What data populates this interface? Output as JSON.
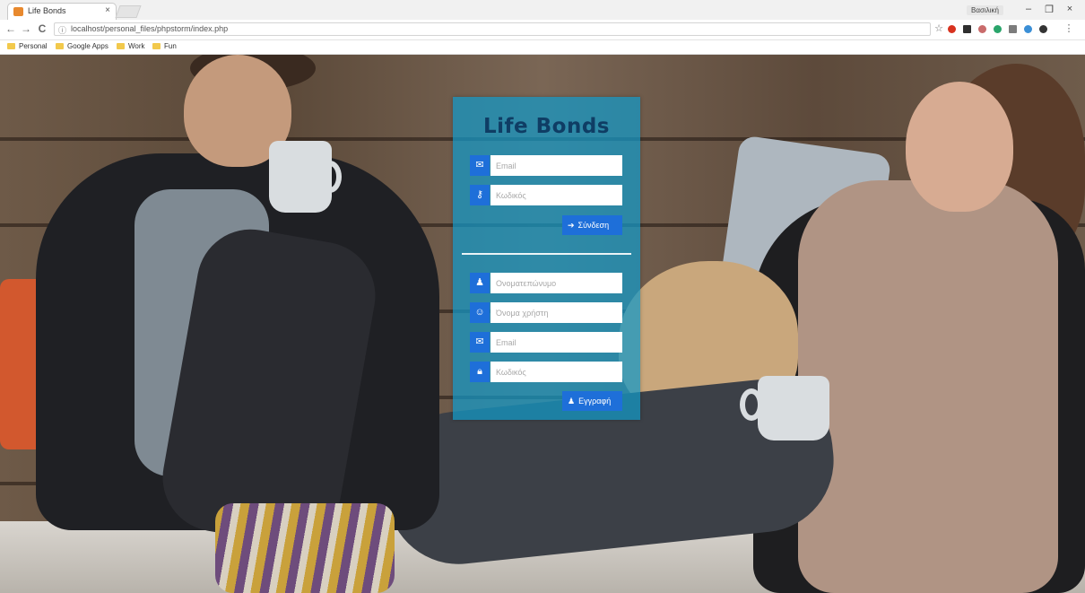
{
  "browser": {
    "tab_title": "Life Bonds",
    "tab_close": "×",
    "profile": "Βασιλική",
    "url": "localhost/personal_files/phpstorm/index.php",
    "win_minimize": "–",
    "win_maximize": "❐",
    "win_close": "×",
    "back": "←",
    "forward": "→",
    "reload": "C",
    "info": "ⓘ",
    "star": "☆",
    "menu": "⋮",
    "bookmarks": [
      "Personal",
      "Google Apps",
      "Work",
      "Fun"
    ]
  },
  "login": {
    "brand": "Life Bonds",
    "email_placeholder": "Email",
    "password_placeholder": "Κωδικός",
    "submit_label": "Σύνδεση",
    "submit_icon": "sign-in-icon"
  },
  "register": {
    "fullname_placeholder": "Ονοματεπώνυμο",
    "username_placeholder": "Όνομα χρήστη",
    "email_placeholder": "Email",
    "password_placeholder": "Κωδικός",
    "submit_label": "Εγγραφή",
    "submit_icon": "user-plus-icon"
  },
  "colors": {
    "card": "#1298c8",
    "brand_text": "#0f3d64",
    "accent": "#1e6fd9"
  }
}
